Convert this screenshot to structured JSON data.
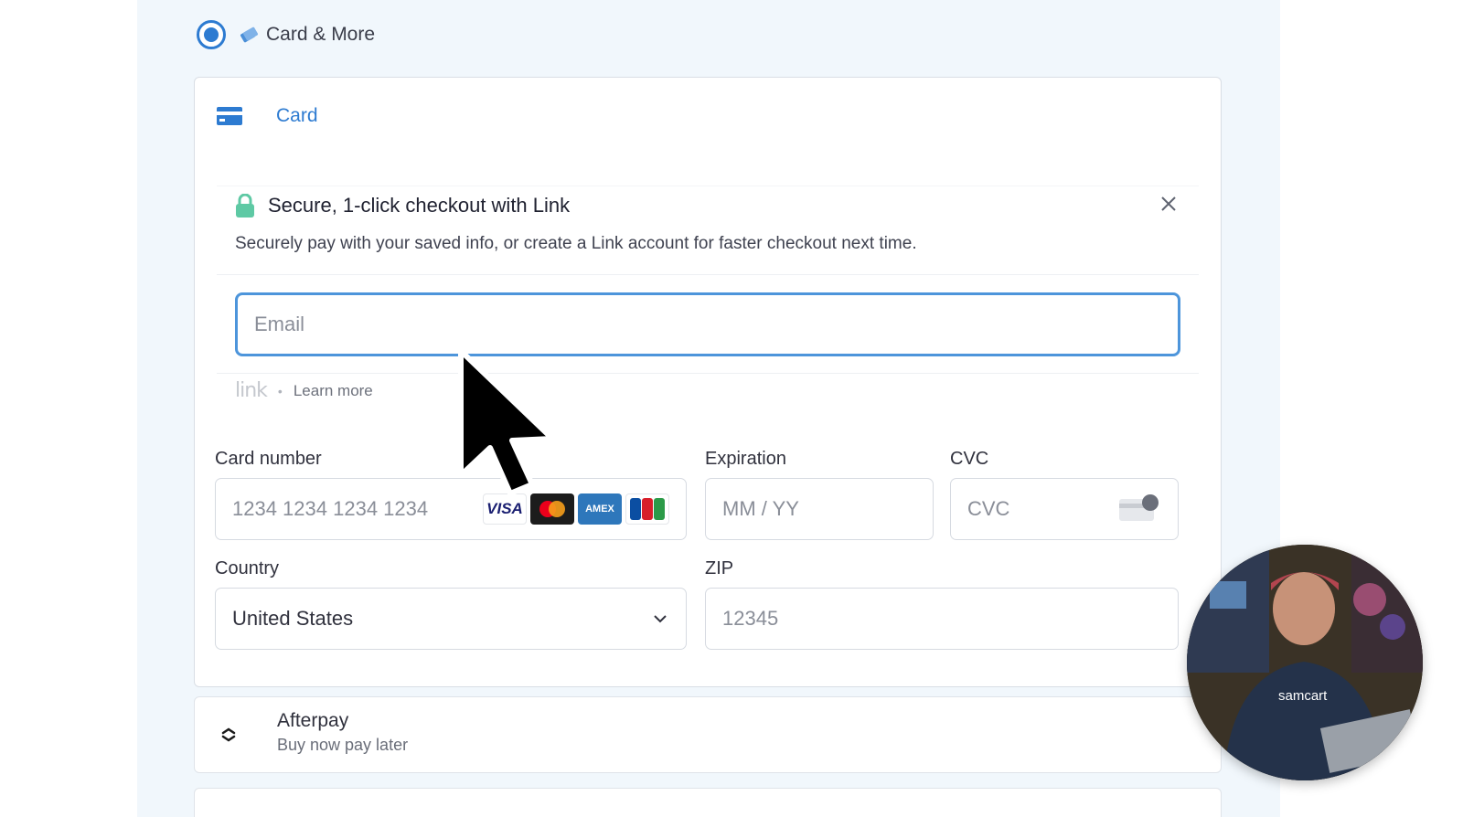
{
  "payment_method": {
    "label": "Card & More",
    "selected": true
  },
  "card_tab": {
    "label": "Card"
  },
  "link": {
    "title": "Secure, 1-click checkout with Link",
    "description": "Securely pay with your saved info, or create a Link account for faster checkout next time.",
    "email_placeholder": "Email",
    "logo_text": "link",
    "separator": "•",
    "learn_more": "Learn more"
  },
  "card_form": {
    "card_number_label": "Card number",
    "card_number_placeholder": "1234 1234 1234 1234",
    "expiration_label": "Expiration",
    "expiration_placeholder": "MM / YY",
    "cvc_label": "CVC",
    "cvc_placeholder": "CVC",
    "country_label": "Country",
    "country_value": "United States",
    "zip_label": "ZIP",
    "zip_placeholder": "12345",
    "brands": {
      "visa": "VISA",
      "amex": "AMEX"
    }
  },
  "afterpay": {
    "title": "Afterpay",
    "subtitle": "Buy now pay later"
  },
  "webcam": {
    "shirt_text": "samcart"
  },
  "colors": {
    "accent": "#2d7bd1",
    "focus_border": "#4d95db",
    "panel_bg": "#f1f7fc",
    "lock_green": "#5ec9a4"
  }
}
